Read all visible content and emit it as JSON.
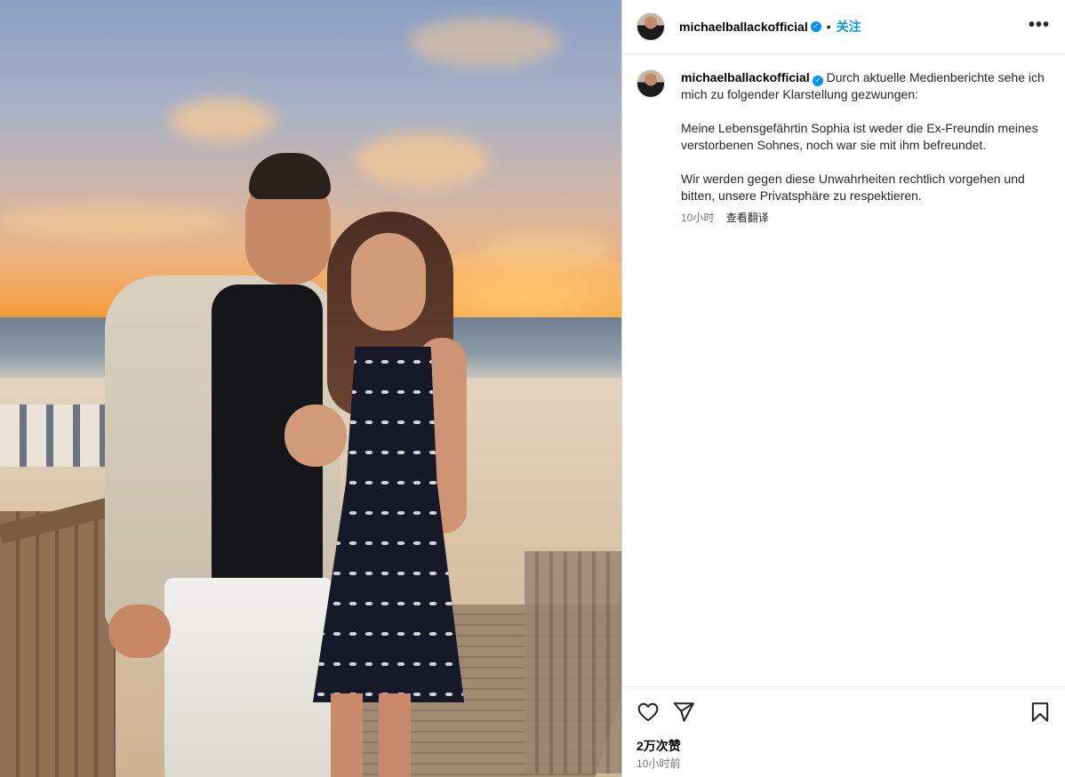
{
  "post": {
    "username": "michaelballackofficial",
    "verified_mark": "✓",
    "separator": "•",
    "follow_label": "关注",
    "more_label": "•••"
  },
  "caption": {
    "username": "michaelballackofficial",
    "text": " Durch aktuelle Medienberichte sehe ich mich zu folgender Klarstellung gezwungen:\n\nMeine Lebensgefährtin Sophia ist weder die Ex-Freundin meines verstorbenen Sohnes, noch war sie mit ihm befreundet.\n\nWir werden gegen diese Unwahrheiten rechtlich vorgehen und bitten, unsere Privatsphäre zu respektieren.",
    "time": "10小时",
    "translate_label": "查看翻译"
  },
  "footer": {
    "likes": "2万次赞",
    "time": "10小时前"
  },
  "icons": {
    "like": "heart-icon",
    "share": "paper-plane-icon",
    "save": "bookmark-icon",
    "more": "more-horizontal-icon"
  }
}
